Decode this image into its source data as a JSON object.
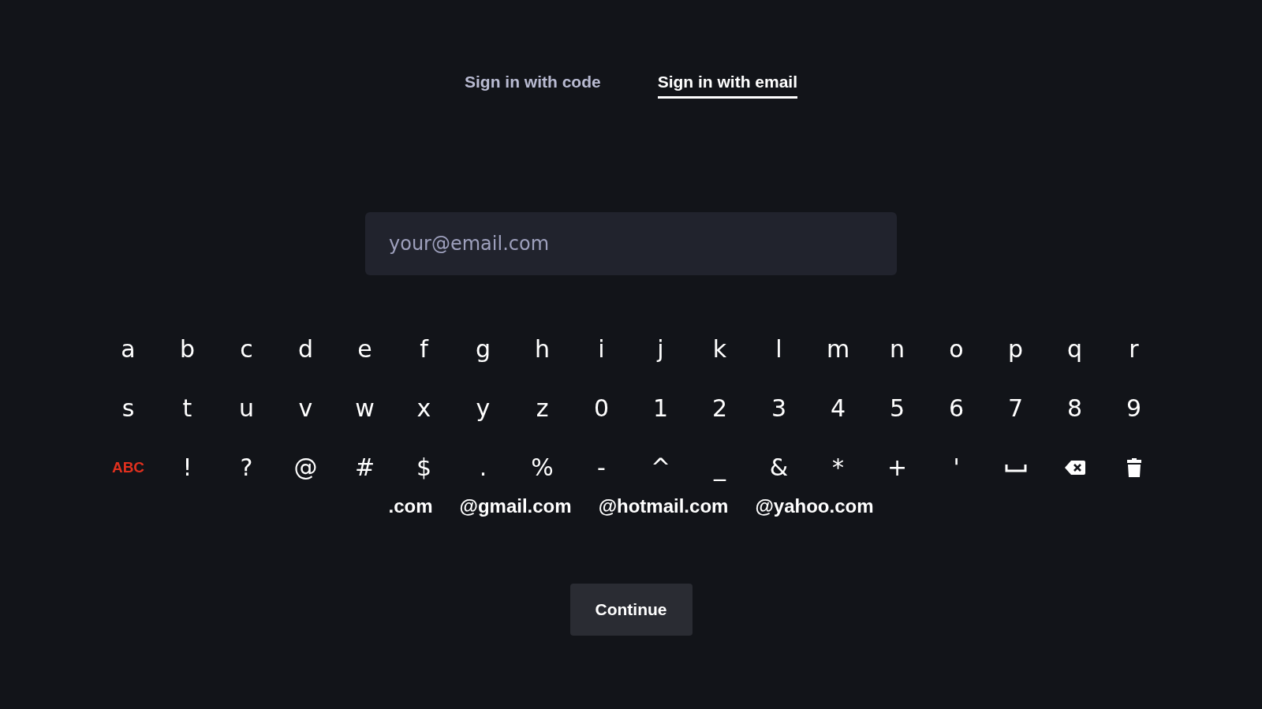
{
  "tabs": [
    {
      "label": "Sign in with code",
      "selected": false
    },
    {
      "label": "Sign in with email",
      "selected": true
    }
  ],
  "email_field": {
    "placeholder": "your@email.com"
  },
  "keyboard": {
    "rows": [
      [
        {
          "kind": "char",
          "label": "a"
        },
        {
          "kind": "char",
          "label": "b"
        },
        {
          "kind": "char",
          "label": "c"
        },
        {
          "kind": "char",
          "label": "d"
        },
        {
          "kind": "char",
          "label": "e"
        },
        {
          "kind": "char",
          "label": "f"
        },
        {
          "kind": "char",
          "label": "g"
        },
        {
          "kind": "char",
          "label": "h"
        },
        {
          "kind": "char",
          "label": "i"
        },
        {
          "kind": "char",
          "label": "j"
        },
        {
          "kind": "char",
          "label": "k"
        },
        {
          "kind": "char",
          "label": "l"
        },
        {
          "kind": "char",
          "label": "m"
        },
        {
          "kind": "char",
          "label": "n"
        },
        {
          "kind": "char",
          "label": "o"
        },
        {
          "kind": "char",
          "label": "p"
        },
        {
          "kind": "char",
          "label": "q"
        },
        {
          "kind": "char",
          "label": "r"
        }
      ],
      [
        {
          "kind": "char",
          "label": "s"
        },
        {
          "kind": "char",
          "label": "t"
        },
        {
          "kind": "char",
          "label": "u"
        },
        {
          "kind": "char",
          "label": "v"
        },
        {
          "kind": "char",
          "label": "w"
        },
        {
          "kind": "char",
          "label": "x"
        },
        {
          "kind": "char",
          "label": "y"
        },
        {
          "kind": "char",
          "label": "z"
        },
        {
          "kind": "char",
          "label": "0"
        },
        {
          "kind": "char",
          "label": "1"
        },
        {
          "kind": "char",
          "label": "2"
        },
        {
          "kind": "char",
          "label": "3"
        },
        {
          "kind": "char",
          "label": "4"
        },
        {
          "kind": "char",
          "label": "5"
        },
        {
          "kind": "char",
          "label": "6"
        },
        {
          "kind": "char",
          "label": "7"
        },
        {
          "kind": "char",
          "label": "8"
        },
        {
          "kind": "char",
          "label": "9"
        }
      ],
      [
        {
          "kind": "mode",
          "label": "ABC"
        },
        {
          "kind": "char",
          "label": "!"
        },
        {
          "kind": "char",
          "label": "?"
        },
        {
          "kind": "char",
          "label": "@"
        },
        {
          "kind": "char",
          "label": "#"
        },
        {
          "kind": "char",
          "label": "$"
        },
        {
          "kind": "char",
          "label": "."
        },
        {
          "kind": "char",
          "label": "%"
        },
        {
          "kind": "char",
          "label": "-"
        },
        {
          "kind": "char",
          "label": "^"
        },
        {
          "kind": "char",
          "label": "_"
        },
        {
          "kind": "char",
          "label": "&"
        },
        {
          "kind": "char",
          "label": "*"
        },
        {
          "kind": "char",
          "label": "+"
        },
        {
          "kind": "char",
          "label": "'"
        },
        {
          "kind": "space"
        },
        {
          "kind": "backspace"
        },
        {
          "kind": "clear"
        }
      ]
    ],
    "suffixes": [
      ".com",
      "@gmail.com",
      "@hotmail.com",
      "@yahoo.com"
    ]
  },
  "continue_button": {
    "label": "Continue"
  }
}
